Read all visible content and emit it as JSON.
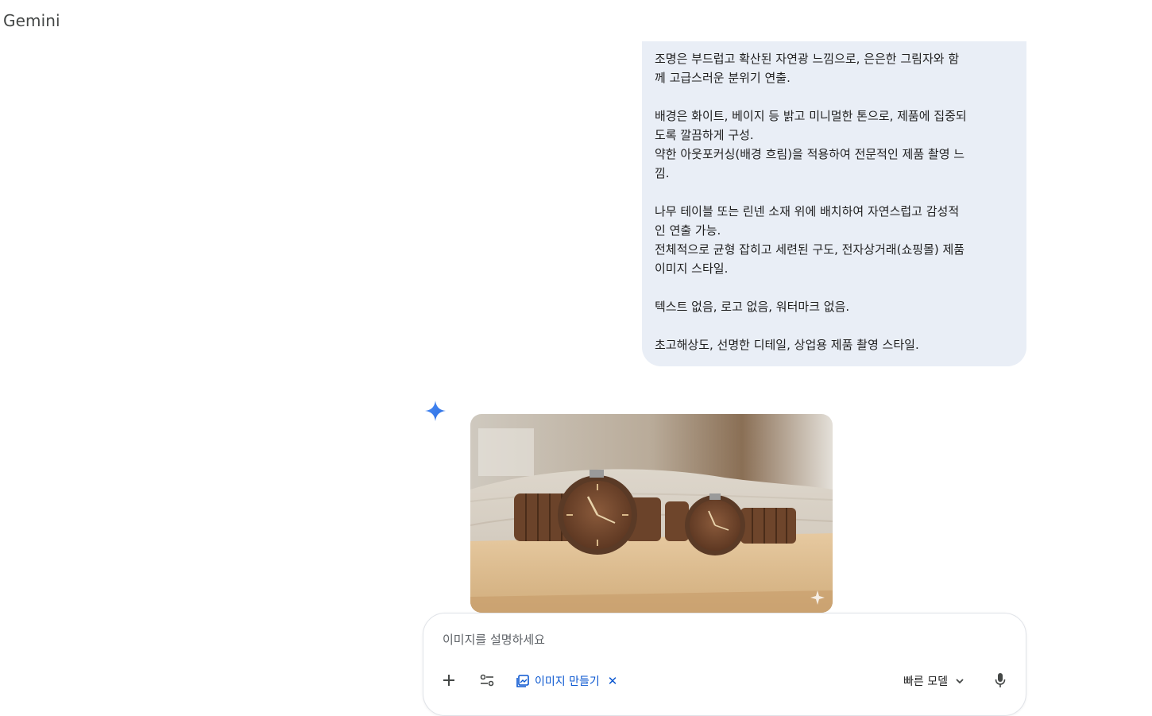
{
  "app": {
    "title": "Gemini"
  },
  "conversation": {
    "user_message": {
      "paragraphs": [
        [
          "조명은 부드럽고 확산된 자연광 느낌으로, 은은한 그림자와 함",
          "께 고급스러운 분위기 연출."
        ],
        [
          "배경은 화이트, 베이지 등 밝고 미니멀한 톤으로, 제품에 집중되",
          "도록 깔끔하게 구성.",
          "약한 아웃포커싱(배경 흐림)을 적용하여 전문적인 제품 촬영 느",
          "낌."
        ],
        [
          "나무 테이블 또는 린넨 소재 위에 배치하여 자연스럽고 감성적",
          "인 연출 가능.",
          "전체적으로 균형 잡히고 세련된 구도, 전자상거래(쇼핑몰) 제품",
          "이미지 스타일."
        ],
        [
          "텍스트 없음, 로고 없음, 워터마크 없음."
        ],
        [
          "초고해상도, 선명한 디테일, 상업용 제품 촬영 스타일."
        ]
      ]
    },
    "response": {
      "icon": "gemini-spark-icon",
      "image": {
        "subject": "pair-of-wooden-watches"
      }
    }
  },
  "composer": {
    "placeholder": "이미지를 설명하세요",
    "value": "",
    "add_icon": "plus-icon",
    "tools_icon": "tools-sliders-icon",
    "tool_chip": {
      "icon": "image-gallery-icon",
      "label": "이미지 만들기",
      "close": "✕"
    },
    "model": {
      "label": "빠른 모델",
      "icon": "chevron-down-icon"
    },
    "mic_icon": "microphone-icon"
  },
  "colors": {
    "bubble_bg": "#e9eef6",
    "accent_blue": "#0b57d0",
    "spark_blue": "#4285f4"
  }
}
